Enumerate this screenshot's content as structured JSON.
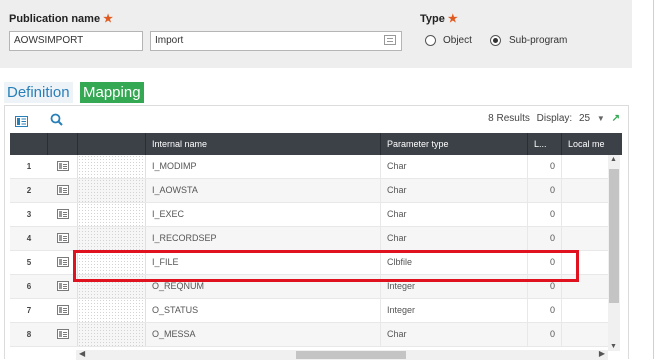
{
  "header": {
    "publication_name_label": "Publication name",
    "required_mark": "★",
    "publication_name_value": "AOWSIMPORT",
    "import_field_value": "Import",
    "type_label": "Type",
    "type_options": [
      "Object",
      "Sub-program"
    ],
    "type_selected": "Sub-program"
  },
  "tabs": [
    "Definition",
    "Mapping"
  ],
  "active_tab": "Mapping",
  "toolbar": {
    "results_text": "8 Results",
    "display_label": "Display:",
    "display_value": "25"
  },
  "grid": {
    "columns": [
      "Internal name",
      "Parameter type",
      "L...",
      "Local me"
    ],
    "rows": [
      {
        "num": "1",
        "name": "I_MODIMP",
        "type": "Char",
        "length": "0"
      },
      {
        "num": "2",
        "name": "I_AOWSTA",
        "type": "Char",
        "length": "0"
      },
      {
        "num": "3",
        "name": "I_EXEC",
        "type": "Char",
        "length": "0"
      },
      {
        "num": "4",
        "name": "I_RECORDSEP",
        "type": "Char",
        "length": "0"
      },
      {
        "num": "5",
        "name": "I_FILE",
        "type": "Clbfile",
        "length": "0"
      },
      {
        "num": "6",
        "name": "O_REQNUM",
        "type": "Integer",
        "length": "0"
      },
      {
        "num": "7",
        "name": "O_STATUS",
        "type": "Integer",
        "length": "0"
      },
      {
        "num": "8",
        "name": "O_MESSA",
        "type": "Char",
        "length": "0"
      }
    ],
    "highlighted_row": "5"
  },
  "colors": {
    "accent_green": "#34a853",
    "tab_blue": "#2980b9",
    "required_orange": "#e05a1f",
    "highlight_red": "#e0121f",
    "header_dark": "#3c4148"
  }
}
